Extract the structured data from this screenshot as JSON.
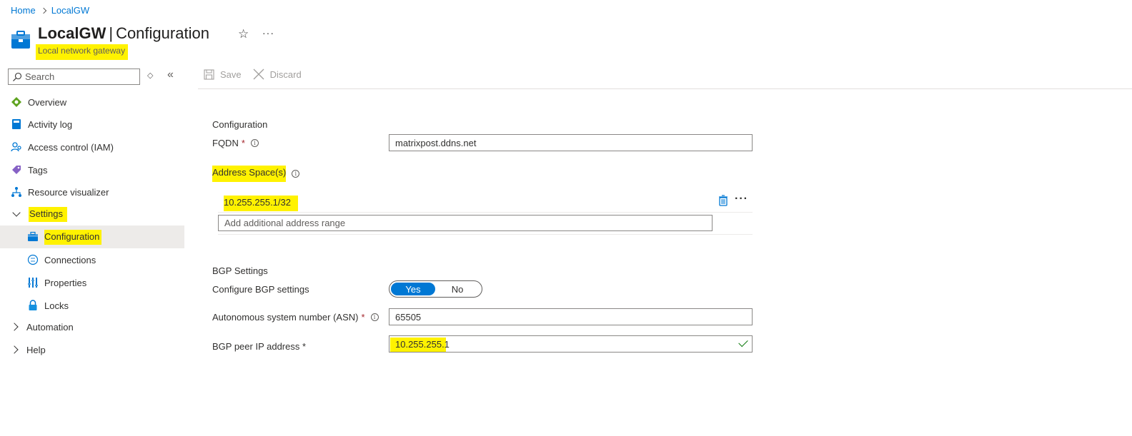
{
  "breadcrumb": {
    "home": "Home",
    "current": "LocalGW"
  },
  "header": {
    "resource_name": "LocalGW",
    "separator": "|",
    "page_name": "Configuration",
    "subtitle": "Local network gateway",
    "favorite_icon": "star-icon",
    "more_icon": "more-icon"
  },
  "sidebar": {
    "search_placeholder": "Search",
    "items": [
      {
        "label": "Overview",
        "icon": "overview-icon"
      },
      {
        "label": "Activity log",
        "icon": "activity-log-icon"
      },
      {
        "label": "Access control (IAM)",
        "icon": "iam-icon"
      },
      {
        "label": "Tags",
        "icon": "tag-icon"
      },
      {
        "label": "Resource visualizer",
        "icon": "visualizer-icon"
      },
      {
        "label": "Settings",
        "expanded": true
      },
      {
        "label": "Configuration",
        "icon": "configuration-icon",
        "selected": true
      },
      {
        "label": "Connections",
        "icon": "connections-icon"
      },
      {
        "label": "Properties",
        "icon": "properties-icon"
      },
      {
        "label": "Locks",
        "icon": "lock-icon"
      },
      {
        "label": "Automation",
        "expanded": false
      },
      {
        "label": "Help",
        "expanded": false
      }
    ]
  },
  "toolbar": {
    "save_label": "Save",
    "discard_label": "Discard"
  },
  "form": {
    "configuration_title": "Configuration",
    "fqdn_label": "FQDN",
    "required_mark": "*",
    "fqdn_value": "matrixpost.ddns.net",
    "address_space_label": "Address Space(s)",
    "address_space_value": "10.255.255.1/32",
    "address_placeholder": "Add additional address range",
    "bgp_title": "BGP Settings",
    "configure_bgp_label": "Configure BGP settings",
    "bgp_yes": "Yes",
    "bgp_no": "No",
    "bgp_selected": "Yes",
    "asn_label": "Autonomous system number (ASN)",
    "asn_value": "65505",
    "peer_ip_label": "BGP peer IP address",
    "peer_ip_value": "10.255.255.1"
  },
  "colors": {
    "accent": "#0078d4",
    "highlight": "#fff200",
    "required": "#a4262c",
    "valid": "#107c10"
  }
}
